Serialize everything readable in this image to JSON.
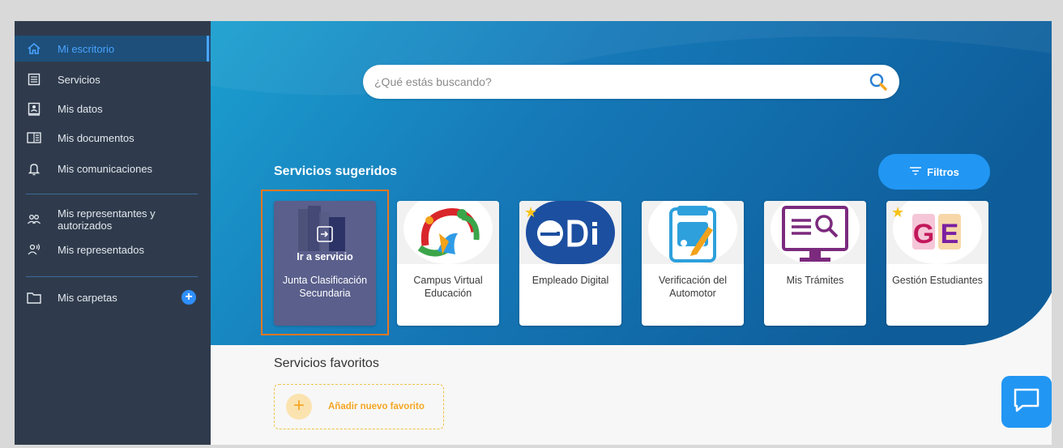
{
  "sidebar": {
    "items": [
      {
        "label": "Mi escritorio",
        "icon": "home-icon",
        "active": true
      },
      {
        "label": "Servicios",
        "icon": "list-icon"
      },
      {
        "label": "Mis datos",
        "icon": "id-card-icon"
      },
      {
        "label": "Mis documentos",
        "icon": "documents-icon"
      },
      {
        "label": "Mis comunicaciones",
        "icon": "bell-icon"
      },
      {
        "label": "Mis representantes y autorizados",
        "icon": "users-icon"
      },
      {
        "label": "Mis representados",
        "icon": "user-voice-icon"
      },
      {
        "label": "Mis carpetas",
        "icon": "folder-icon"
      }
    ]
  },
  "search": {
    "placeholder": "¿Qué estás buscando?"
  },
  "suggested": {
    "title": "Servicios sugeridos",
    "filters_label": "Filtros",
    "go_label": "Ir a servicio",
    "cards": [
      {
        "name": "Junta Clasificación Secundaria",
        "hovered": true
      },
      {
        "name": "Campus Virtual Educación"
      },
      {
        "name": "Empleado Digital",
        "favorite": true
      },
      {
        "name": "Verificación del Automotor"
      },
      {
        "name": "Mis Trámites"
      },
      {
        "name": "Gestión Estudiantes",
        "favorite": true
      }
    ]
  },
  "favorites": {
    "title": "Servicios favoritos",
    "add_label": "Añadir nuevo favorito"
  },
  "colors": {
    "sidebar": "#2f3b4c",
    "accent": "#2196f3",
    "highlight": "#e87722"
  }
}
